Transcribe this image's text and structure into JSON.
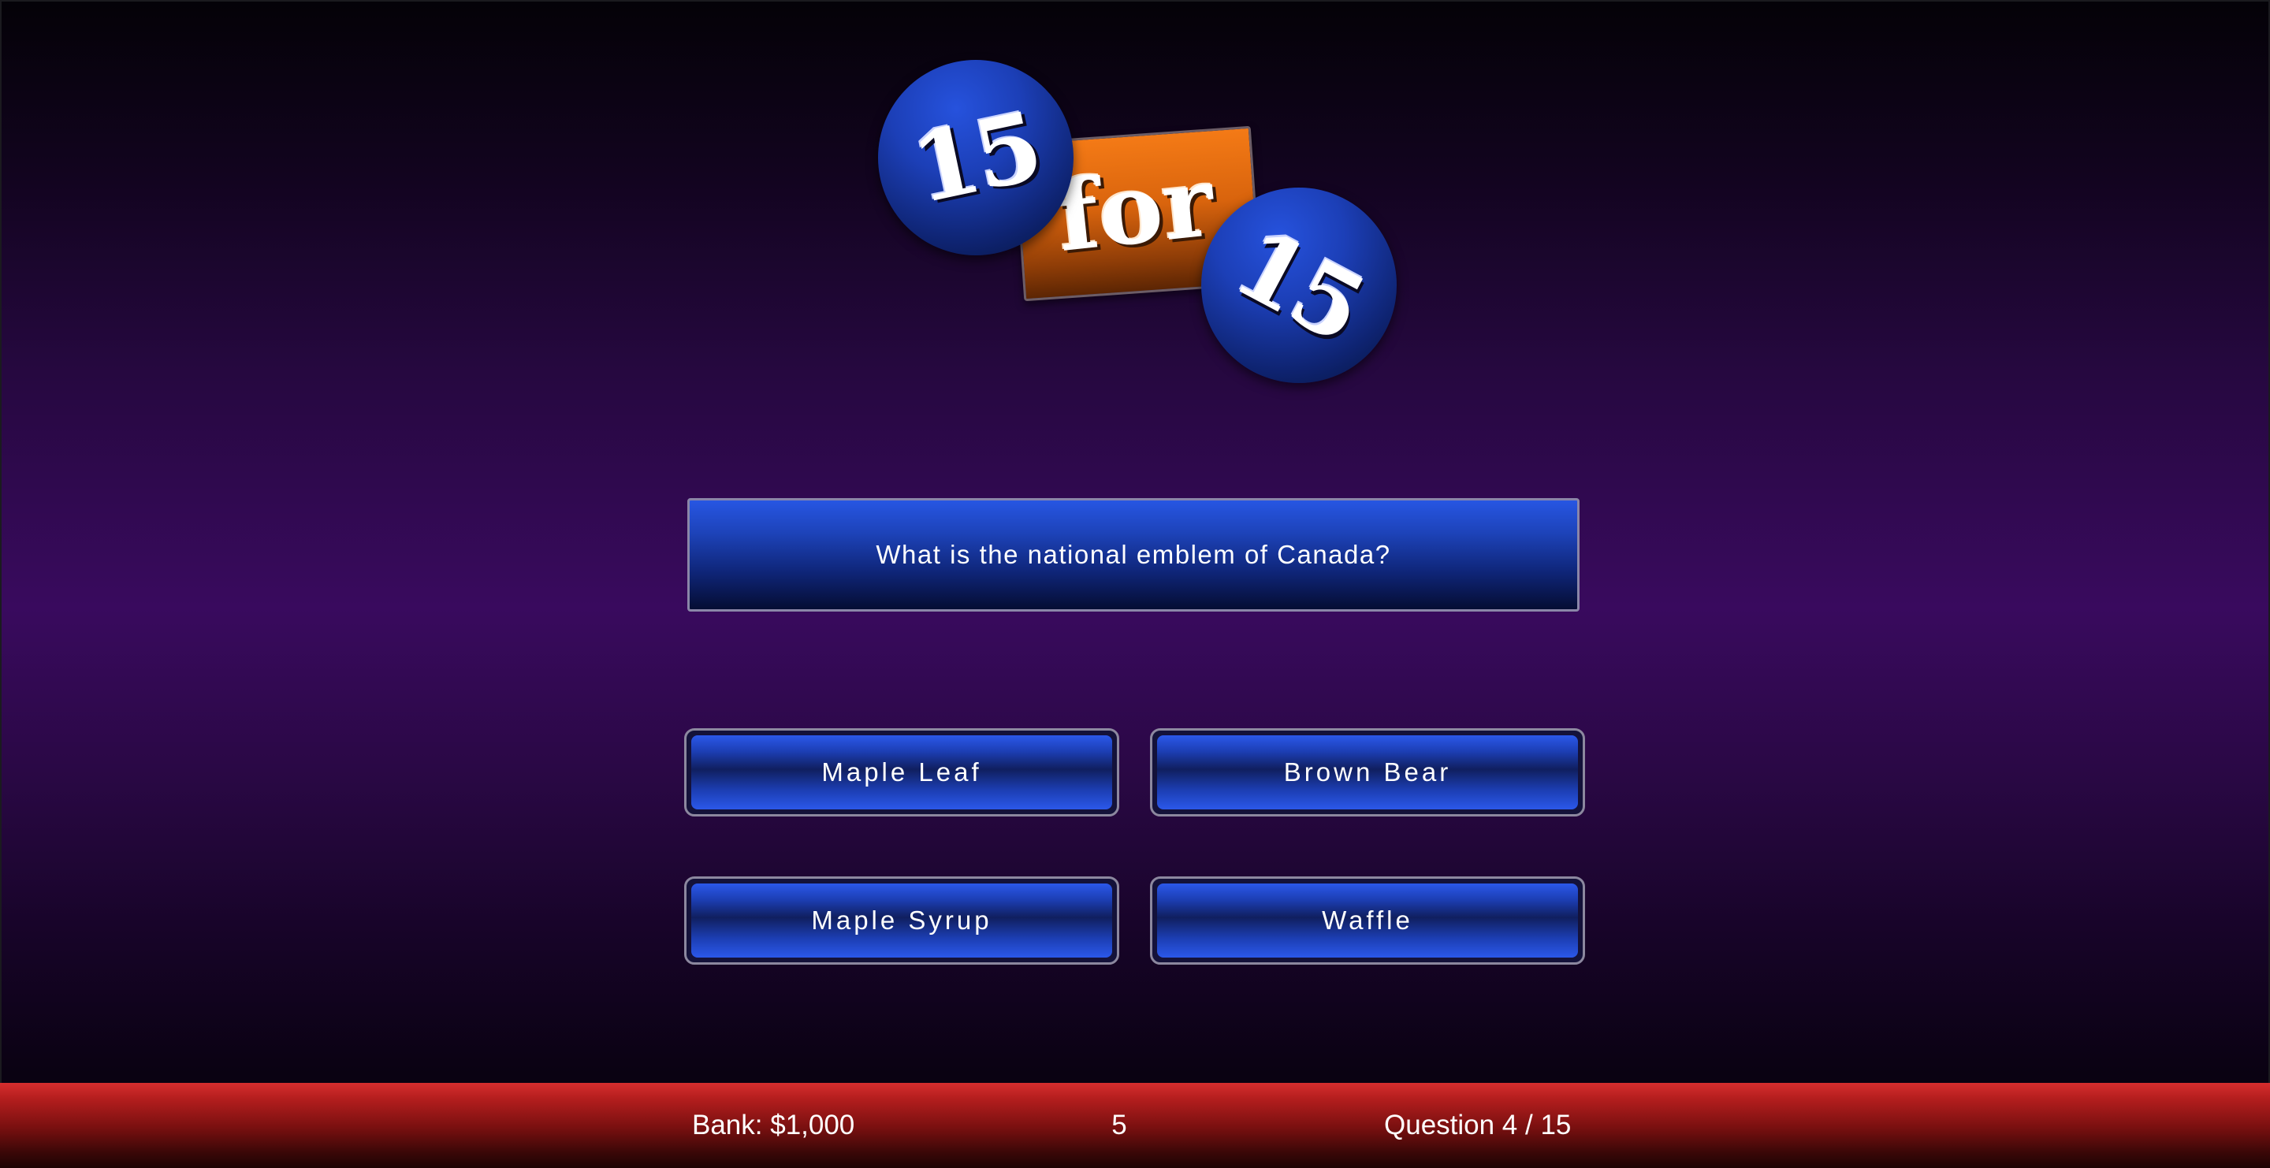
{
  "logo": {
    "number_left": "15",
    "word": "for",
    "number_right": "15"
  },
  "question": {
    "text": "What is the national emblem of Canada?"
  },
  "answers": [
    {
      "label": "Maple Leaf"
    },
    {
      "label": "Brown Bear"
    },
    {
      "label": "Maple Syrup"
    },
    {
      "label": "Waffle"
    }
  ],
  "status_bar": {
    "bank": "Bank: $1,000",
    "timer": "5",
    "progress": "Question 4 / 15"
  },
  "colors": {
    "background_accent": "#390a5e",
    "panel_blue": "#1d43b9",
    "logo_orange": "#f47a16",
    "status_bar_red": "#b51e1e"
  }
}
